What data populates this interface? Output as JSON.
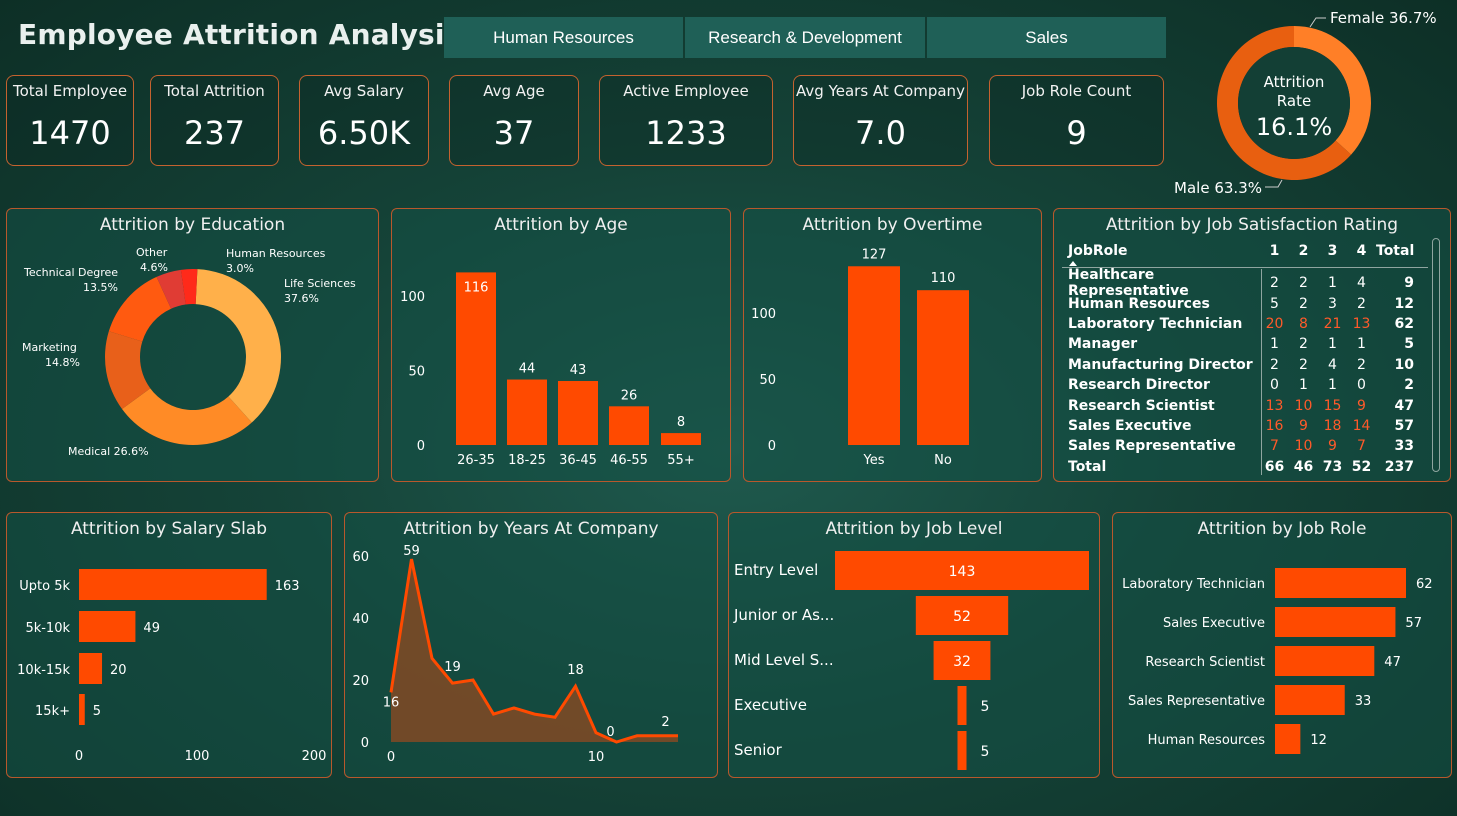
{
  "title": "Employee Attrition Analysis",
  "tabs": [
    "Human Resources",
    "Research & Development",
    "Sales"
  ],
  "kpis": [
    {
      "label": "Total Employee",
      "value": "1470"
    },
    {
      "label": "Total Attrition",
      "value": "237"
    },
    {
      "label": "Avg Salary",
      "value": "6.50K"
    },
    {
      "label": "Avg Age",
      "value": "37"
    },
    {
      "label": "Active Employee",
      "value": "1233"
    },
    {
      "label": "Avg Years At Company",
      "value": "7.0"
    },
    {
      "label": "Job Role Count",
      "value": "9"
    }
  ],
  "colors": {
    "accent": "#ff4a00",
    "border": "#c4622f",
    "tab": "#1f6057",
    "panel": "#1a5247"
  },
  "chart_data": [
    {
      "type": "pie",
      "id": "gender",
      "center_label": "Attrition Rate",
      "center_value": "16.1%",
      "categories": [
        "Female",
        "Male"
      ],
      "values": [
        36.7,
        63.3
      ],
      "labels": [
        "Female 36.7%",
        "Male 63.3%"
      ],
      "colors": [
        "#ff7f27",
        "#e85f10"
      ]
    },
    {
      "type": "pie",
      "id": "education",
      "title": "Attrition by Education",
      "categories": [
        "Life Sciences",
        "Medical",
        "Marketing",
        "Technical Degree",
        "Other",
        "Human Resources"
      ],
      "values": [
        37.6,
        26.6,
        14.8,
        13.5,
        4.6,
        3.0
      ],
      "labels": [
        "Life Sciences 37.6%",
        "Medical 26.6%",
        "Marketing 14.8%",
        "Technical Degree 13.5%",
        "Other 4.6%",
        "Human Resources 3.0%"
      ],
      "colors": [
        "#ffb04a",
        "#ff8b26",
        "#e8601a",
        "#ff5a10",
        "#e03c34",
        "#ff2a1a"
      ]
    },
    {
      "type": "bar",
      "id": "age",
      "title": "Attrition by Age",
      "categories": [
        "26-35",
        "18-25",
        "36-45",
        "46-55",
        "55+"
      ],
      "values": [
        116,
        44,
        43,
        26,
        8
      ],
      "yticks": [
        "0",
        "50",
        "100"
      ],
      "ylim": [
        0,
        125
      ]
    },
    {
      "type": "bar",
      "id": "overtime",
      "title": "Attrition by Overtime",
      "categories": [
        "Yes",
        "No"
      ],
      "values": [
        127,
        110
      ],
      "yticks": [
        "0",
        "50",
        "100"
      ],
      "ylim": [
        0,
        140
      ]
    },
    {
      "type": "table",
      "id": "satisfaction",
      "title": "Attrition by Job Satisfaction Rating",
      "columns": [
        "JobRole",
        "1",
        "2",
        "3",
        "4",
        "Total"
      ],
      "rows": [
        {
          "role": "Healthcare Representative",
          "v": [
            "2",
            "2",
            "1",
            "4"
          ],
          "total": "9"
        },
        {
          "role": "Human Resources",
          "v": [
            "5",
            "2",
            "3",
            "2"
          ],
          "total": "12"
        },
        {
          "role": "Laboratory Technician",
          "v": [
            "20",
            "8",
            "21",
            "13"
          ],
          "total": "62",
          "hl": true
        },
        {
          "role": "Manager",
          "v": [
            "1",
            "2",
            "1",
            "1"
          ],
          "total": "5"
        },
        {
          "role": "Manufacturing Director",
          "v": [
            "2",
            "2",
            "4",
            "2"
          ],
          "total": "10"
        },
        {
          "role": "Research Director",
          "v": [
            "0",
            "1",
            "1",
            "0"
          ],
          "total": "2"
        },
        {
          "role": "Research Scientist",
          "v": [
            "13",
            "10",
            "15",
            "9"
          ],
          "total": "47",
          "hl": true
        },
        {
          "role": "Sales Executive",
          "v": [
            "16",
            "9",
            "18",
            "14"
          ],
          "total": "57",
          "hl": true
        },
        {
          "role": "Sales Representative",
          "v": [
            "7",
            "10",
            "9",
            "7"
          ],
          "total": "33",
          "hl": true
        }
      ],
      "totals": {
        "role": "Total",
        "v": [
          "66",
          "46",
          "73",
          "52"
        ],
        "total": "237"
      }
    },
    {
      "type": "bar",
      "id": "salary",
      "title": "Attrition by Salary Slab",
      "orientation": "horizontal",
      "categories": [
        "Upto 5k",
        "5k-10k",
        "10k-15k",
        "15k+"
      ],
      "values": [
        163,
        49,
        20,
        5
      ],
      "xticks": [
        "0",
        "100",
        "200"
      ],
      "xlim": [
        0,
        200
      ]
    },
    {
      "type": "area",
      "id": "years",
      "title": "Attrition by Years At Company",
      "x": [
        0,
        1,
        2,
        3,
        4,
        5,
        6,
        7,
        8,
        9,
        10,
        11,
        12,
        13,
        14
      ],
      "values": [
        16,
        59,
        27,
        19,
        20,
        9,
        11,
        9,
        8,
        18,
        3,
        0,
        2,
        2,
        2
      ],
      "data_labels": [
        {
          "x": 0,
          "label": "16"
        },
        {
          "x": 1,
          "label": "59"
        },
        {
          "x": 3,
          "label": "19"
        },
        {
          "x": 9,
          "label": "18"
        },
        {
          "x": 11,
          "label": "0"
        },
        {
          "x": 13,
          "label": "2"
        }
      ],
      "yticks": [
        "0",
        "20",
        "40",
        "60"
      ],
      "xticks": [
        "0",
        "10"
      ],
      "ylim": [
        0,
        60
      ]
    },
    {
      "type": "bar",
      "id": "joblevel",
      "title": "Attrition by Job Level",
      "orientation": "funnel",
      "categories": [
        "Entry Level",
        "Junior or As...",
        "Mid Level S...",
        "Executive",
        "Senior"
      ],
      "values": [
        143,
        52,
        32,
        5,
        5
      ]
    },
    {
      "type": "bar",
      "id": "jobrole",
      "title": "Attrition by Job Role",
      "orientation": "horizontal",
      "categories": [
        "Laboratory Technician",
        "Sales Executive",
        "Research Scientist",
        "Sales Representative",
        "Human Resources"
      ],
      "values": [
        62,
        57,
        47,
        33,
        12
      ]
    }
  ]
}
